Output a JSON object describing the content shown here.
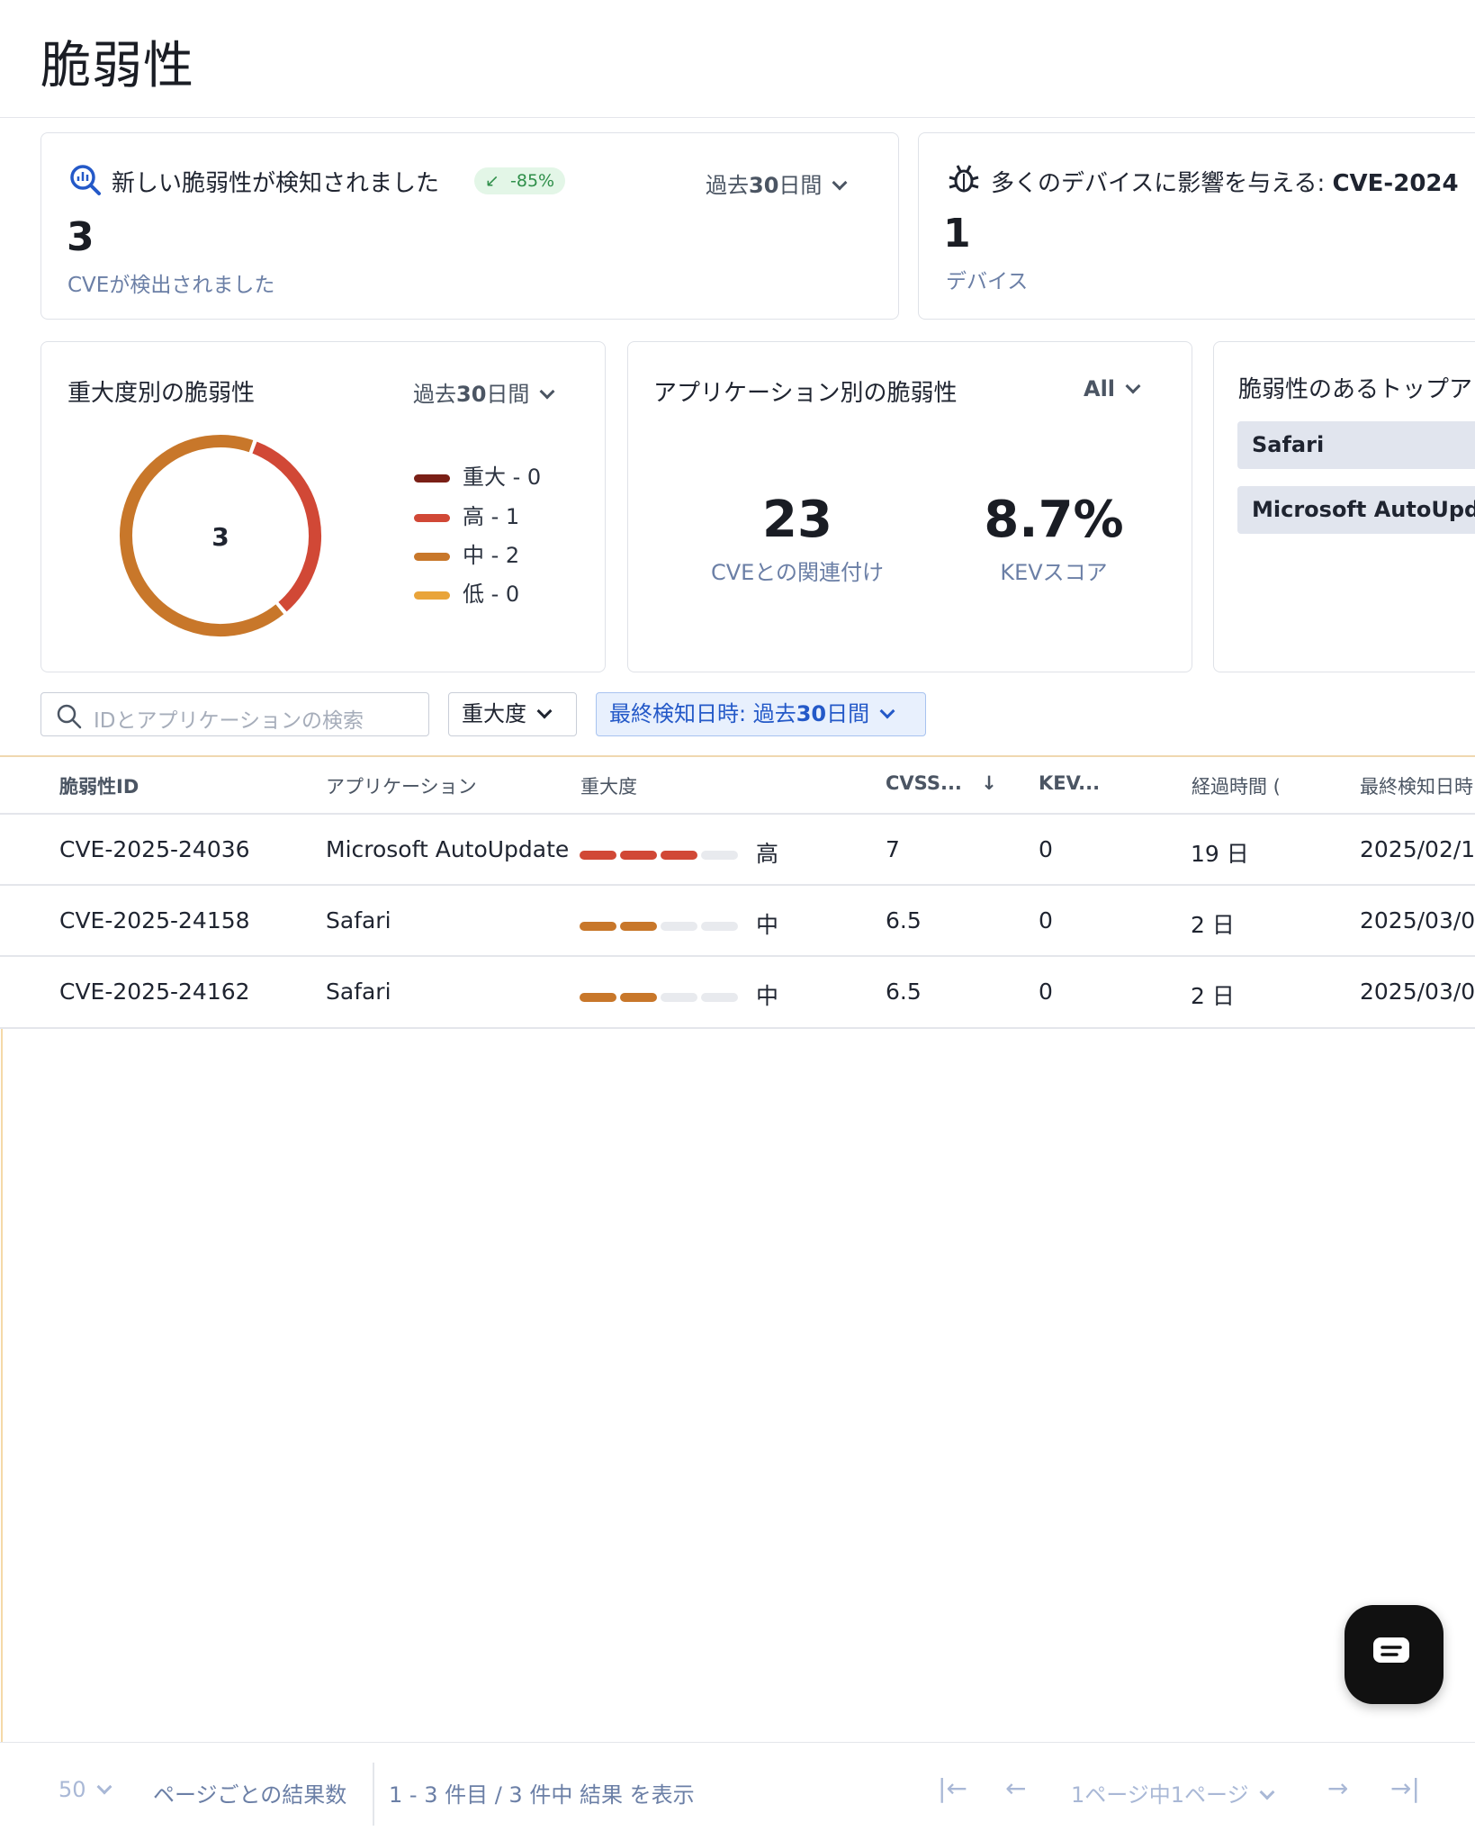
{
  "page": {
    "title": "脆弱性"
  },
  "new_vulns_card": {
    "title": "新しい脆弱性が検知されました",
    "delta": "-85%",
    "period_prefix": "過去",
    "period_bold": "30",
    "period_suffix": "日間",
    "value": "3",
    "label": "CVEが検出されました"
  },
  "devices_card": {
    "title_prefix": "多くのデバイスに影響を与える: ",
    "title_bold": "CVE-2024",
    "value": "1",
    "label": "デバイス"
  },
  "severity_card": {
    "title": "重大度別の脆弱性",
    "period_prefix": "過去",
    "period_bold": "30",
    "period_suffix": "日間",
    "center_value": "3",
    "legend": [
      {
        "label": "重大 - 0",
        "color": "#7a1f16"
      },
      {
        "label": "高 - 1",
        "color": "#d14836"
      },
      {
        "label": "中 - 2",
        "color": "#c8772a"
      },
      {
        "label": "低 - 0",
        "color": "#e9a43a"
      }
    ]
  },
  "chart_data": {
    "type": "pie",
    "categories": [
      "重大",
      "高",
      "中",
      "低"
    ],
    "values": [
      0,
      1,
      2,
      0
    ],
    "colors": [
      "#7a1f16",
      "#d14836",
      "#c8772a",
      "#e9a43a"
    ],
    "center_label": "3"
  },
  "app_card": {
    "title": "アプリケーション別の脆弱性",
    "filter": "All",
    "stat1_value": "23",
    "stat1_label": "CVEとの関連付け",
    "stat2_value": "8.7%",
    "stat2_label": "KEVスコア"
  },
  "top_apps_card": {
    "title": "脆弱性のあるトップア",
    "apps": [
      "Safari",
      "Microsoft AutoUpdate"
    ]
  },
  "filters": {
    "search_placeholder": "IDとアプリケーションの検索",
    "severity_label": "重大度",
    "last_detected_prefix": "最終検知日時: 過去",
    "last_detected_bold": "30",
    "last_detected_suffix": "日間"
  },
  "table": {
    "headers": {
      "id": "脆弱性ID",
      "app": "アプリケーション",
      "severity": "重大度",
      "cvss": "CVSS...",
      "kev": "KEV...",
      "elapsed": "経過時間 (",
      "last": "最終検知日時"
    },
    "rows": [
      {
        "id": "CVE-2025-24036",
        "app": "Microsoft AutoUpdate",
        "severity_label": "高",
        "severity_level": 3,
        "cvss": "7",
        "kev": "0",
        "elapsed": "19 日",
        "last": "2025/02/1"
      },
      {
        "id": "CVE-2025-24158",
        "app": "Safari",
        "severity_label": "中",
        "severity_level": 2,
        "cvss": "6.5",
        "kev": "0",
        "elapsed": "2 日",
        "last": "2025/03/0"
      },
      {
        "id": "CVE-2025-24162",
        "app": "Safari",
        "severity_label": "中",
        "severity_level": 2,
        "cvss": "6.5",
        "kev": "0",
        "elapsed": "2 日",
        "last": "2025/03/0"
      }
    ]
  },
  "footer": {
    "page_size": "50",
    "page_size_label": "ページごとの結果数",
    "range_text": "1 - 3 件目 / 3 件中 結果 を表示",
    "page_text": "1ページ中1ページ"
  },
  "colors": {
    "high": "#d14836",
    "medium": "#c8772a",
    "empty": "#e8eaee",
    "accent": "#2459c8"
  }
}
